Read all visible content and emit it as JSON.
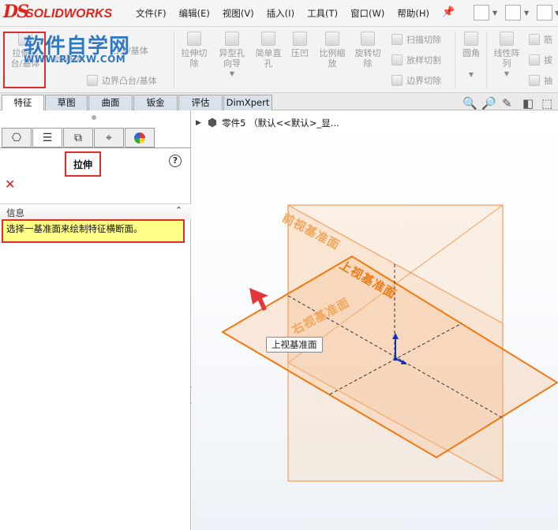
{
  "app": {
    "logo_ds": "DS",
    "logo_text": "SOLIDWORKS"
  },
  "menu": [
    "文件(F)",
    "编辑(E)",
    "视图(V)",
    "插入(I)",
    "工具(T)",
    "窗口(W)",
    "帮助(H)"
  ],
  "watermark": {
    "title": "软件自学网",
    "url": "WWW.RJZXW.COM"
  },
  "ribbon": {
    "extrude_boss": [
      "拉伸凸",
      "台/基体"
    ],
    "revolve_boss": [
      "凸台/基体",
      "台/基体"
    ],
    "boundary_boss": "边界凸台/基体",
    "extrude_cut": [
      "拉伸切",
      "除"
    ],
    "hole_wizard": [
      "异型孔",
      "向导"
    ],
    "simple_hole": [
      "简单直",
      "孔"
    ],
    "indent": "压凹",
    "scale": [
      "比例缩",
      "放"
    ],
    "revolve_cut": [
      "旋转切",
      "除"
    ],
    "sweep_cut": "扫描切除",
    "loft_cut": "放样切割",
    "boundary_cut": "边界切除",
    "fillet": "圆角",
    "linear_pattern": [
      "线性阵",
      "列"
    ],
    "rib": "筋",
    "draft": "拔",
    "shell": "抽"
  },
  "tabs": [
    "特征",
    "草图",
    "曲面",
    "钣金",
    "评估",
    "DimXpert"
  ],
  "property_manager": {
    "title": "拉伸",
    "help": "?",
    "cancel": "✕",
    "section_label": "信息",
    "collapse": "⌃",
    "message": "选择一基准面来绘制特征横断面。"
  },
  "feature_tree": {
    "expand": "▶",
    "part_label": "零件5 （默认<<默认>_显..."
  },
  "planes": {
    "front": "前视基准面",
    "top": "上视基准面",
    "right": "右视基准面"
  },
  "tooltip": "上视基准面",
  "colors": {
    "accent_red": "#e12c2c",
    "plane_orange": "#f2922a",
    "selected_plane": "#f07a10",
    "watermark_blue": "#2f78c4",
    "message_bg": "#ffff88"
  }
}
